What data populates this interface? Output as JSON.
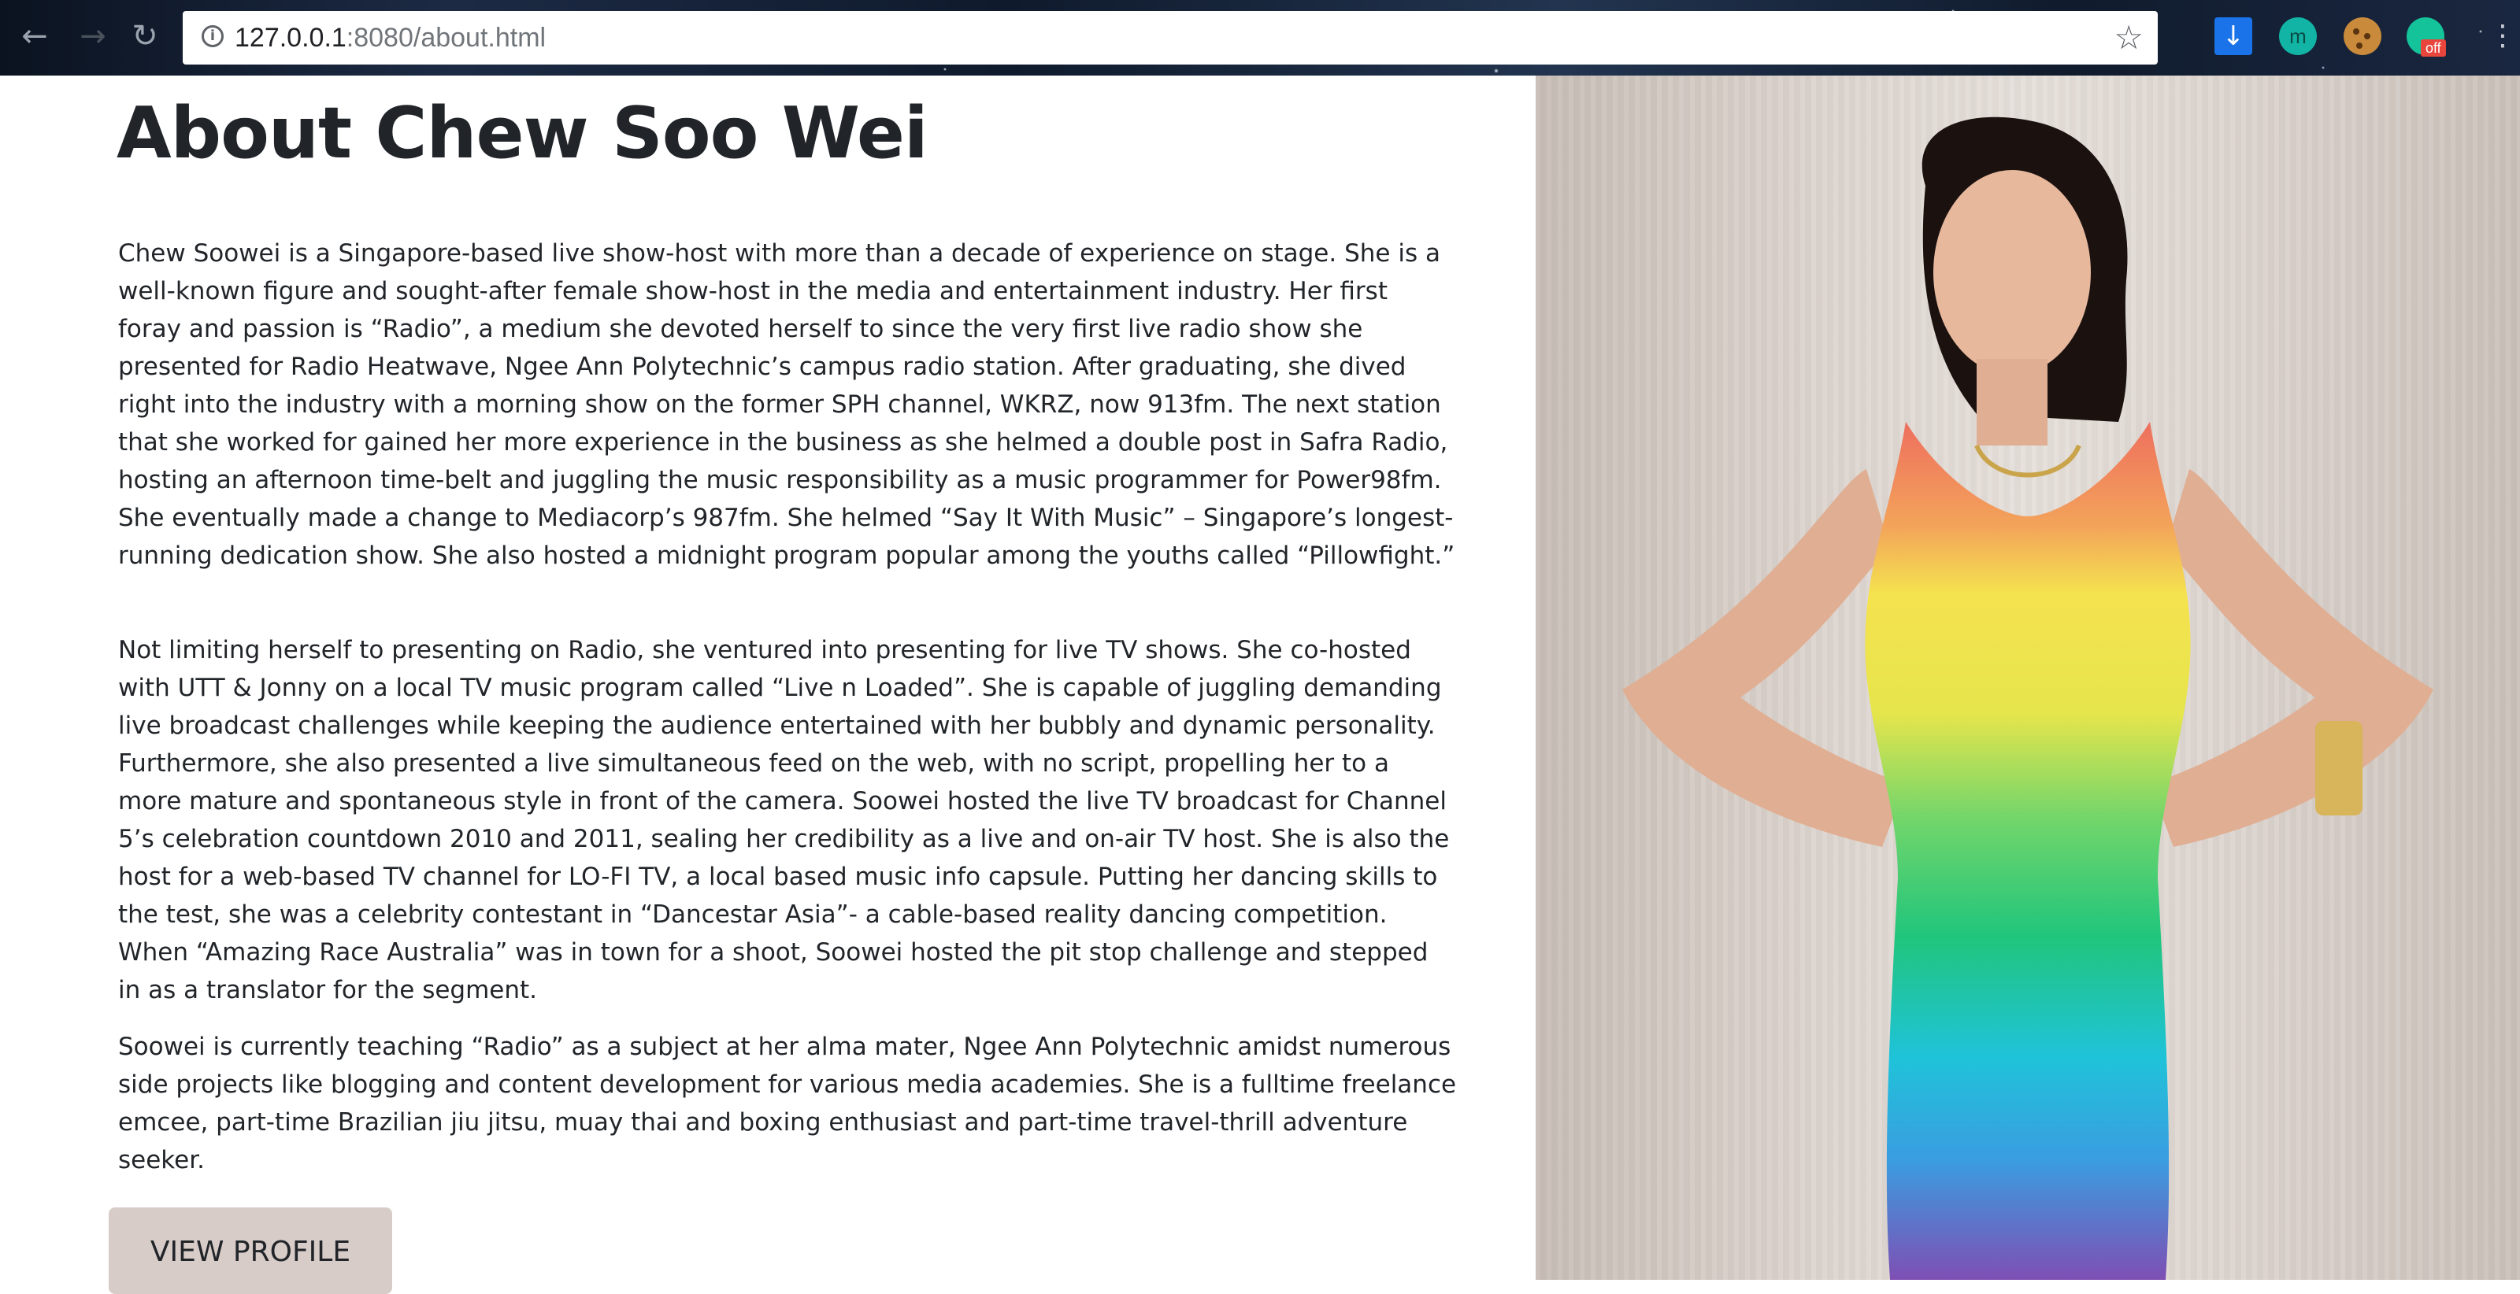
{
  "browser": {
    "url_host": "127.0.0.1",
    "url_port_path": ":8080/about.html",
    "extension_badge": "off",
    "extension_m": "m",
    "icons": [
      "back-arrow-icon",
      "forward-arrow-icon",
      "reload-icon",
      "info-icon",
      "star-icon",
      "download-icon",
      "cookie-icon",
      "grammarly-icon",
      "menu-icon"
    ]
  },
  "page": {
    "title": "About Chew Soo Wei",
    "paragraphs": [
      "Chew Soowei is a Singapore-based live show-host with more than a decade of experience on stage. She is a well-known figure and sought-after female show-host in the media and entertainment industry. Her first foray and passion is “Radio”, a medium she devoted herself to since the very first live radio show she presented for Radio Heatwave, Ngee Ann Polytechnic’s campus radio station. After graduating, she dived right into the industry with a morning show on the former SPH channel, WKRZ, now 913fm. The next station that she worked for gained her more experience in the business as she helmed a double post in Safra Radio, hosting an afternoon time-belt and juggling the music responsibility as a music programmer for Power98fm. She eventually made a change to Mediacorp’s 987fm. She helmed “Say It With Music” – Singapore’s longest-running dedication show. She also hosted a midnight program popular among the youths called “Pillowfight.”",
      "Not limiting herself to presenting on Radio, she ventured into presenting for live TV shows. She co-hosted with UTT & Jonny on a local TV music program called “Live n Loaded”. She is capable of juggling demanding live broadcast challenges while keeping the audience entertained with her bubbly and dynamic personality. Furthermore, she also presented a live simultaneous feed on the web, with no script, propelling her to a more mature and spontaneous style in front of the camera. Soowei hosted the live TV broadcast for Channel 5’s celebration countdown 2010 and 2011, sealing her credibility as a live and on-air TV host. She is also the host for a web-based TV channel for LO-FI TV, a local based music info capsule. Putting her dancing skills to the test, she was a celebrity contestant in “Dancestar Asia”- a cable-based reality dancing competition. When “Amazing Race Australia” was in town for a shoot, Soowei hosted the pit stop challenge and stepped in as a translator for the segment.",
      "Soowei is currently teaching “Radio” as a subject at her alma mater, Ngee Ann Polytechnic amidst numerous side projects like blogging and content development for various media academies. She is a fulltime freelance emcee, part-time Brazilian jiu jitsu, muay thai and boxing enthusiast and part-time travel-thrill adventure seeker."
    ],
    "button_label": "VIEW PROFILE"
  },
  "colors": {
    "text": "#212529",
    "button_bg": "#d8ccc8",
    "photo_bg": "#ddd5cf"
  }
}
